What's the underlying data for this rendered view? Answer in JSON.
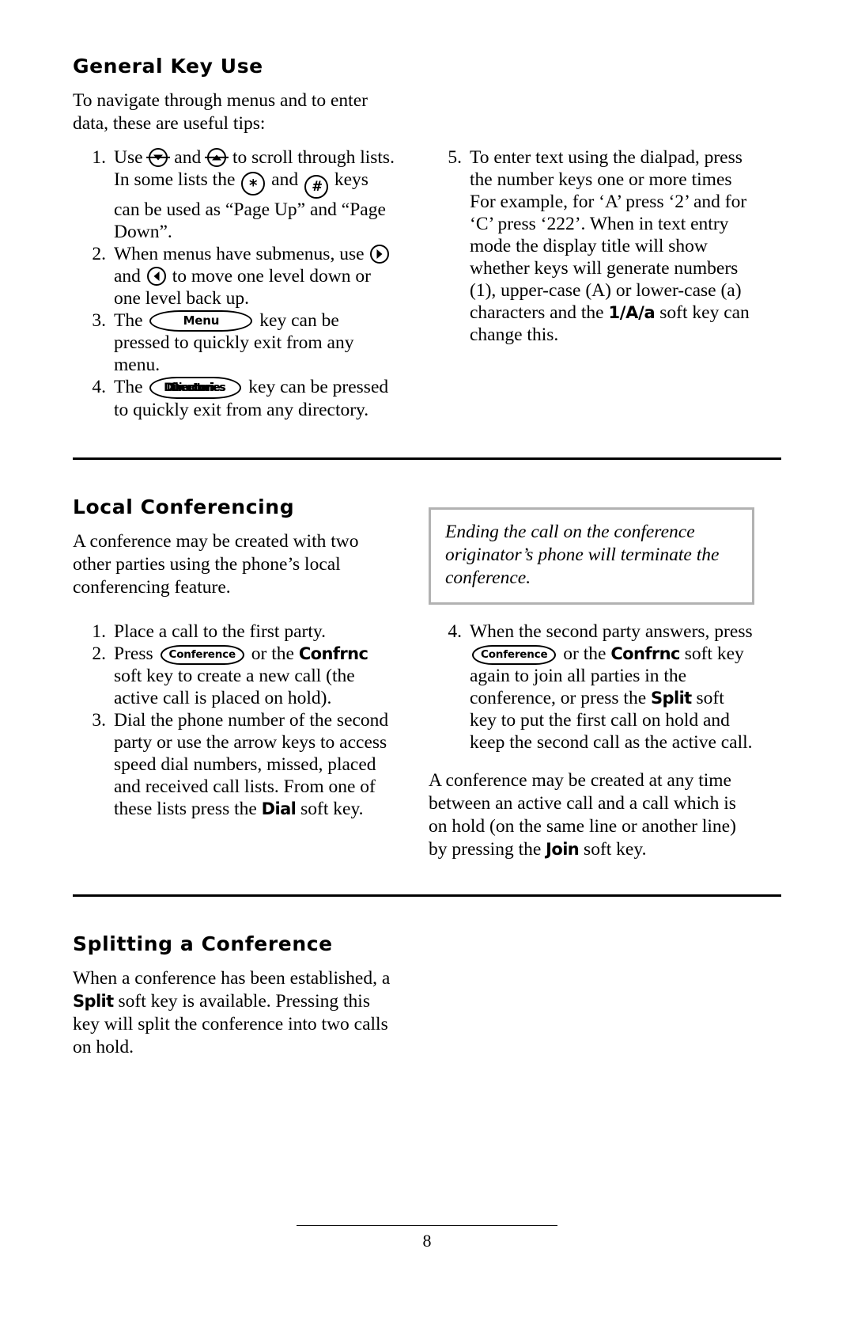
{
  "page": {
    "number": "8"
  },
  "sections": {
    "general_key_use": {
      "heading": "General Key Use",
      "intro": "To navigate through menus and to enter data, these are useful tips:",
      "steps_left": [
        {
          "num": "1.",
          "parts": {
            "t1": "Use",
            "key_down": "scroll-down-key",
            "t2": "and",
            "key_up": "scroll-up-key",
            "t3": "to scroll through lists. In some lists the",
            "key_star": "*",
            "t4": "and",
            "key_pound": "#",
            "t5": "keys can be used as “Page Up” and “Page Down”."
          }
        },
        {
          "num": "2.",
          "parts": {
            "t1": "When menus have submenus, use",
            "key_right": "right-arrow-key",
            "t2": "and",
            "key_left": "left-arrow-key",
            "t3": "to move one level down or one level back up."
          }
        },
        {
          "num": "3.",
          "parts": {
            "t1": "The",
            "key_label": "Menu",
            "t2": "key can be pressed to quickly exit from any menu."
          }
        },
        {
          "num": "4.",
          "parts": {
            "t1": "The",
            "key_label": "Directories",
            "t2": "key can be pressed to quickly exit from any directory."
          }
        }
      ],
      "steps_right": [
        {
          "num": "5.",
          "parts": {
            "t1": "To enter text using the dialpad, press the number keys one or more times For example, for ‘A’ press ‘2’ and for ‘C’ press ‘222’.  When in text entry mode the display title will show whether keys will generate numbers (1), upper-case (A) or lower-case (a) characters and the",
            "soft_key": "1/A/a",
            "t2": "soft key can change this."
          }
        }
      ]
    },
    "local_conferencing": {
      "heading": "Local Conferencing",
      "intro": "A conference may be created with two other parties using the phone’s local conferencing feature.",
      "callout": "Ending the call on the conference originator’s phone will terminate the conference.",
      "steps_left": [
        {
          "num": "1.",
          "parts": {
            "t1": "Place a call to the first party."
          }
        },
        {
          "num": "2.",
          "parts": {
            "t1": "Press",
            "key_label": "Conference",
            "t2": "or the",
            "soft_key": "Confrnc",
            "t3": "soft key to create a new call (the active call is placed on hold)."
          }
        },
        {
          "num": "3.",
          "parts": {
            "t1": "Dial the phone number of the second party or use the arrow keys to access speed dial numbers, missed, placed and received call lists.  From one of these lists press the",
            "soft_key": "Dial",
            "t2": "soft key."
          }
        }
      ],
      "steps_right": [
        {
          "num": "4.",
          "parts": {
            "t1": "When the second party answers, press",
            "key_label": "Conference",
            "t2": "or the",
            "soft_key": "Confrnc",
            "t3": "soft key again to join all parties in the conference, or press the",
            "soft_key2": "Split",
            "t4": "soft key to put the first call on hold and keep the second call as the active call."
          }
        }
      ],
      "closing": {
        "t1": "A conference may be created at any time between an active call and a call which is on hold (on the same line or another line) by pressing the",
        "soft_key": "Join",
        "t2": "soft key."
      }
    },
    "splitting_a_conference": {
      "heading": "Splitting a Conference",
      "body": {
        "t1": "When a conference has been established, a",
        "soft_key": "Split",
        "t2": "soft key is available.  Pressing this key will split the conference into two calls on hold."
      }
    }
  }
}
